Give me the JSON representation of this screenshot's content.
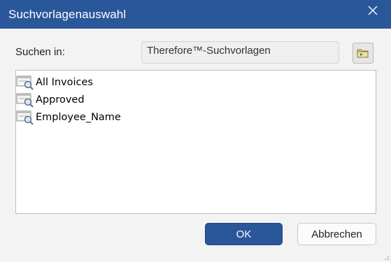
{
  "window": {
    "title": "Suchvorlagenauswahl"
  },
  "search_in": {
    "label": "Suchen in:",
    "value": "Therefore™-Suchvorlagen"
  },
  "templates": [
    {
      "label": "All Invoices",
      "icon": "search-template-icon"
    },
    {
      "label": "Approved",
      "icon": "search-template-icon"
    },
    {
      "label": "Employee_Name",
      "icon": "search-template-icon"
    }
  ],
  "buttons": {
    "ok": "OK",
    "cancel": "Abbrechen"
  },
  "colors": {
    "accent": "#2a579a",
    "background": "#f3f3f3"
  }
}
